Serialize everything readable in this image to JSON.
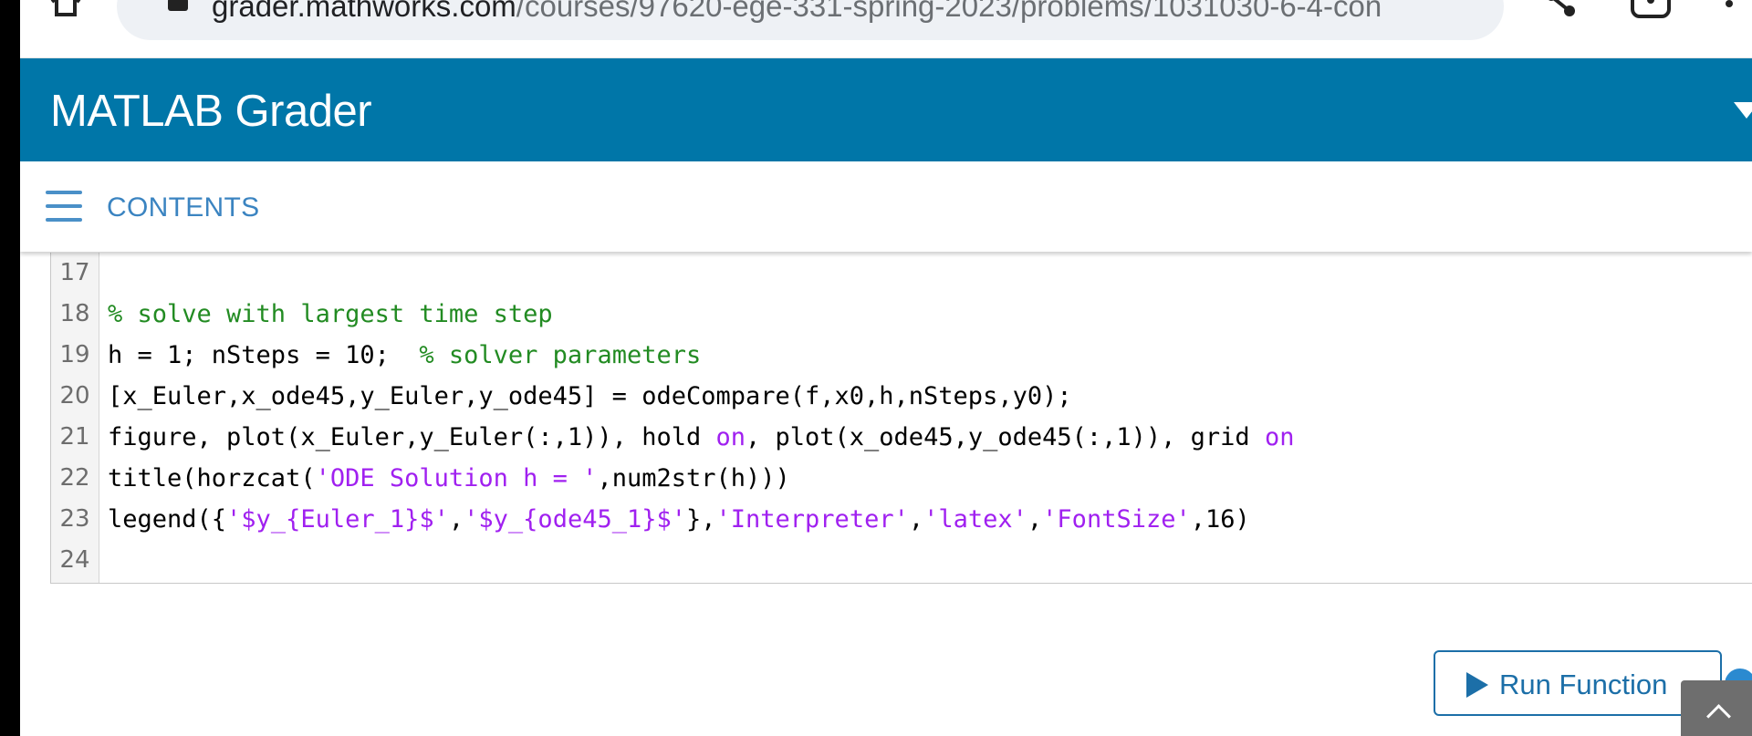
{
  "browser": {
    "url_host": "grader.mathworks.com",
    "url_path": "/courses/97620-ege-331-spring-2023/problems/1031030-6-4-con"
  },
  "header": {
    "title": "MATLAB Grader",
    "background_color": "#0076a8"
  },
  "contents_bar": {
    "label": "CONTENTS"
  },
  "editor": {
    "lines": [
      {
        "number": "17",
        "tokens": []
      },
      {
        "number": "18",
        "tokens": [
          {
            "t": "% solve with largest time step",
            "c": "comment"
          }
        ]
      },
      {
        "number": "19",
        "tokens": [
          {
            "t": "h = 1; nSteps = 10;  ",
            "c": "plain"
          },
          {
            "t": "% solver parameters",
            "c": "comment"
          }
        ]
      },
      {
        "number": "20",
        "tokens": [
          {
            "t": "[x_Euler,x_ode45,y_Euler,y_ode45] = odeCompare(f,x0,h,nSteps,y0);",
            "c": "plain"
          }
        ]
      },
      {
        "number": "21",
        "tokens": [
          {
            "t": "figure, plot(x_Euler,y_Euler(:,1)), hold ",
            "c": "plain"
          },
          {
            "t": "on",
            "c": "keyword"
          },
          {
            "t": ", plot(x_ode45,y_ode45(:,1)), grid ",
            "c": "plain"
          },
          {
            "t": "on",
            "c": "keyword"
          }
        ]
      },
      {
        "number": "22",
        "tokens": [
          {
            "t": "title(horzcat(",
            "c": "plain"
          },
          {
            "t": "'ODE Solution h = '",
            "c": "string"
          },
          {
            "t": ",num2str(h)))",
            "c": "plain"
          }
        ]
      },
      {
        "number": "23",
        "tokens": [
          {
            "t": "legend({",
            "c": "plain"
          },
          {
            "t": "'$y_{Euler_1}$'",
            "c": "string"
          },
          {
            "t": ",",
            "c": "plain"
          },
          {
            "t": "'$y_{ode45_1}$'",
            "c": "string"
          },
          {
            "t": "},",
            "c": "plain"
          },
          {
            "t": "'Interpreter'",
            "c": "string"
          },
          {
            "t": ",",
            "c": "plain"
          },
          {
            "t": "'latex'",
            "c": "string"
          },
          {
            "t": ",",
            "c": "plain"
          },
          {
            "t": "'FontSize'",
            "c": "string"
          },
          {
            "t": ",16)",
            "c": "plain"
          }
        ]
      },
      {
        "number": "24",
        "tokens": []
      }
    ],
    "colors": {
      "comment": "#228b22",
      "string": "#a020f0",
      "keyword": "#a020f0",
      "plain": "#000000"
    }
  },
  "actions": {
    "run_label": "Run Function"
  },
  "icons": {
    "home": "home-icon",
    "lock": "lock-icon",
    "share": "share-icon",
    "lens": "lens-icon",
    "menu": "menu-dots-icon",
    "hamburger": "hamburger-icon",
    "play": "play-icon",
    "help": "help-icon",
    "scroll_top": "chevron-up-icon"
  }
}
